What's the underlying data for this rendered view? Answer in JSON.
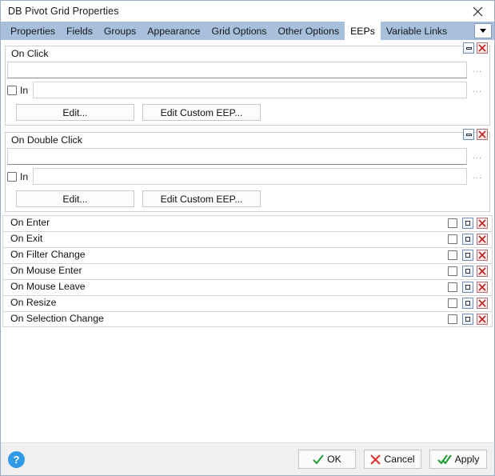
{
  "window": {
    "title": "DB Pivot Grid Properties",
    "close_icon": "close-icon"
  },
  "tabs": {
    "items": [
      {
        "label": "Properties",
        "active": false
      },
      {
        "label": "Fields",
        "active": false
      },
      {
        "label": "Groups",
        "active": false
      },
      {
        "label": "Appearance",
        "active": false
      },
      {
        "label": "Grid Options",
        "active": false
      },
      {
        "label": "Other Options",
        "active": false
      },
      {
        "label": "EEPs",
        "active": true
      },
      {
        "label": "Variable Links",
        "active": false
      }
    ],
    "overflow_icon": "chevron-down-icon"
  },
  "groups": [
    {
      "title": "On Click",
      "main_field_value": "",
      "in_label": "In",
      "in_checked": false,
      "in_field_value": "",
      "ellipsis_label": "...",
      "edit_label": "Edit...",
      "edit_custom_label": "Edit Custom EEP...",
      "minimize_icon": "minimize-icon",
      "delete_icon": "delete-icon"
    },
    {
      "title": "On Double Click",
      "main_field_value": "",
      "in_label": "In",
      "in_checked": false,
      "in_field_value": "",
      "ellipsis_label": "...",
      "edit_label": "Edit...",
      "edit_custom_label": "Edit Custom EEP...",
      "minimize_icon": "minimize-icon",
      "delete_icon": "delete-icon"
    }
  ],
  "collapsed_rows": [
    {
      "label": "On Enter",
      "checked": false
    },
    {
      "label": "On Exit",
      "checked": false
    },
    {
      "label": "On Filter Change",
      "checked": false
    },
    {
      "label": "On Mouse Enter",
      "checked": false
    },
    {
      "label": "On Mouse Leave",
      "checked": false
    },
    {
      "label": "On Resize",
      "checked": false
    },
    {
      "label": "On Selection Change",
      "checked": false
    }
  ],
  "footer": {
    "help_label": "?",
    "ok_label": "OK",
    "cancel_label": "Cancel",
    "apply_label": "Apply"
  },
  "colors": {
    "tabstrip": "#a8c0dc",
    "accent_blue": "#2f9ae8",
    "ok_green": "#1f9b32",
    "cancel_red": "#e03030",
    "footer_bg": "#f0f0f0"
  }
}
